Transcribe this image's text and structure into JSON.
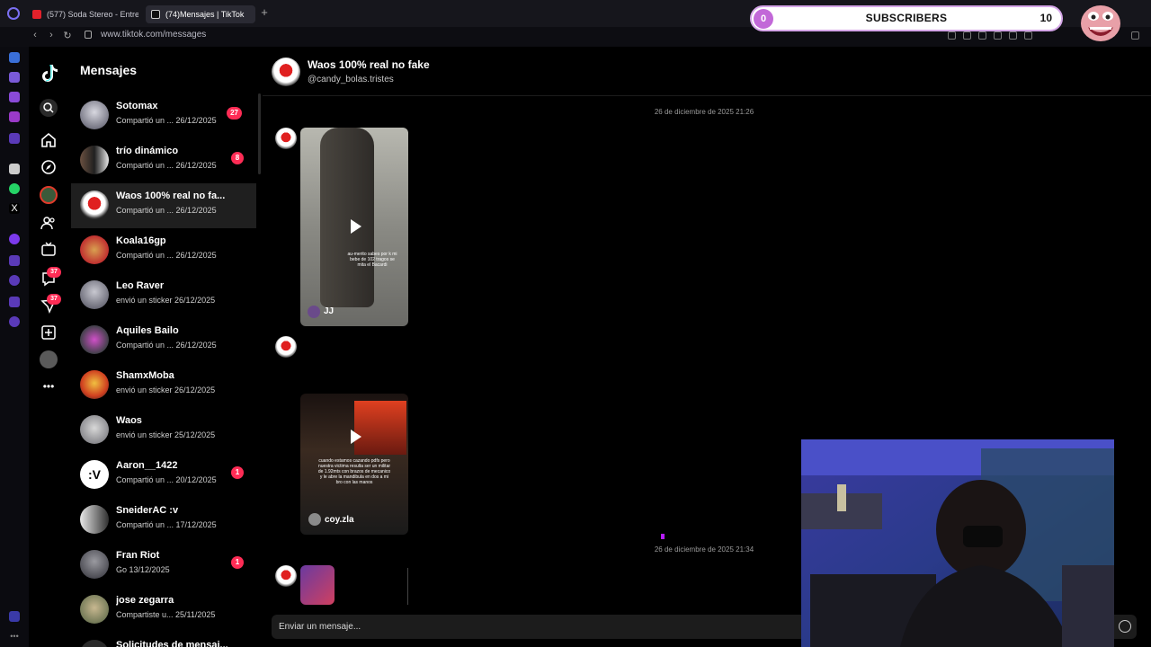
{
  "browser": {
    "tabs": [
      {
        "label": "(577) Soda Stereo - Entre"
      },
      {
        "label": "(74)Mensajes | TikTok"
      }
    ],
    "url": "www.tiktok.com/messages"
  },
  "overlay": {
    "subscribers_current": "0",
    "subscribers_label": "SUBSCRIBERS",
    "subscribers_goal": "10"
  },
  "nav": {
    "badges": [
      "37",
      "37"
    ]
  },
  "messages_panel": {
    "title": "Mensajes",
    "conversations": [
      {
        "name": "Sotomax",
        "preview": "Compartió un ...",
        "date": "26/12/2025",
        "badge": "27"
      },
      {
        "name": "trío dinámico",
        "preview": "Compartió un ...",
        "date": "26/12/2025",
        "badge": "8"
      },
      {
        "name": "Waos 100% real no fa...",
        "preview": "Compartió un ...",
        "date": "26/12/2025",
        "badge": ""
      },
      {
        "name": "Koala16gp",
        "preview": "Compartió un ...",
        "date": "26/12/2025",
        "badge": ""
      },
      {
        "name": "Leo Raver",
        "preview": "envió un sticker",
        "date": "26/12/2025",
        "badge": ""
      },
      {
        "name": "Aquiles Bailo",
        "preview": "Compartió un ...",
        "date": "26/12/2025",
        "badge": ""
      },
      {
        "name": "ShamxMoba",
        "preview": "envió un sticker",
        "date": "26/12/2025",
        "badge": ""
      },
      {
        "name": "Waos",
        "preview": "envió un sticker",
        "date": "25/12/2025",
        "badge": ""
      },
      {
        "name": "Aaron__1422",
        "preview": "Compartió un ...",
        "date": "20/12/2025",
        "badge": "1"
      },
      {
        "name": "SneiderAC :v",
        "preview": "Compartió un ...",
        "date": "17/12/2025",
        "badge": ""
      },
      {
        "name": "Fran Riot",
        "preview": "Go",
        "date": "13/12/2025",
        "badge": "1"
      },
      {
        "name": "jose zegarra",
        "preview": "Compartiste u...",
        "date": "25/11/2025",
        "badge": ""
      },
      {
        "name": "Solicitudes de mensaj...",
        "preview": "",
        "date": "",
        "badge": ""
      }
    ]
  },
  "chat": {
    "name": "Waos 100% real no fake",
    "handle": "@candy_bolas.tristes",
    "timestamps": [
      "26 de diciembre de 2025 21:26",
      "26 de diciembre de 2025 21:34"
    ],
    "videos": [
      {
        "author": "JJ",
        "caption": "au-merito sabes por k mi bebe de 102 tragos se mita el Bacardi"
      },
      {
        "author": "coy.zla",
        "caption": "cuando estamos cazando pdfs pero nuestra victima resulta ser un militar de 1.92mts con brazos de mecanico y le abre la mandibula en dos a mi bro con las manos"
      }
    ],
    "input_placeholder": "Enviar un mensaje..."
  },
  "colors": {
    "tiktok_red": "#fe2c55",
    "subscriber_accent": "#c268d8",
    "background": "#000000"
  }
}
